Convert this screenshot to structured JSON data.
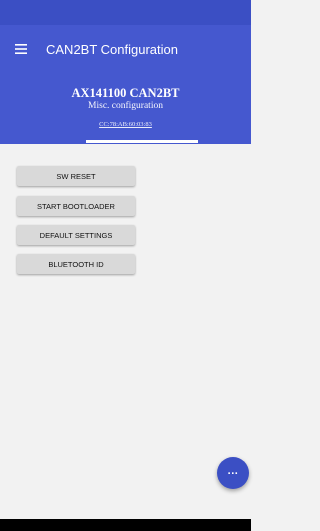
{
  "colors": {
    "primary": "#4558cf",
    "status_bar": "#3b4fc4",
    "background": "#f2f2f2",
    "button": "#d9d9d9"
  },
  "app_bar": {
    "title": "CAN2BT Configuration",
    "menu_icon": "menu-icon"
  },
  "device": {
    "name": "AX141100 CAN2BT",
    "subtitle": "Misc. configuration",
    "mac": "CC:78:AB:60:03:83"
  },
  "actions": [
    {
      "label": "SW RESET"
    },
    {
      "label": "START BOOTLOADER"
    },
    {
      "label": "DEFAULT SETTINGS"
    },
    {
      "label": "BLUETOOTH ID"
    }
  ],
  "fab": {
    "icon": "more-icon",
    "glyph": "..."
  }
}
